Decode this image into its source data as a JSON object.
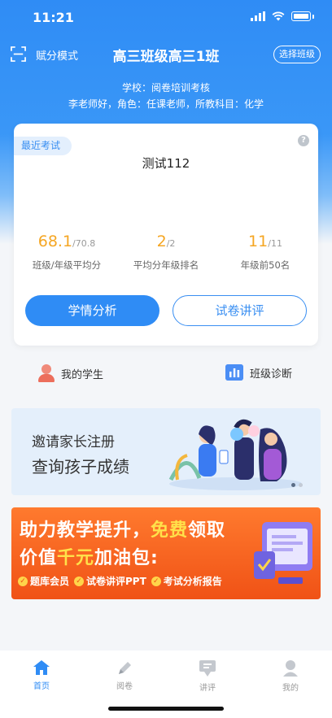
{
  "status_bar": {
    "time": "11:21"
  },
  "topnav": {
    "mode_label": "赋分模式",
    "class_title": "高三班级高三1班",
    "select_class": "选择班级"
  },
  "info": {
    "school": "学校：阅卷培训考核",
    "teacher": "李老师好，角色：任课老师，所教科目：化学"
  },
  "exam_card": {
    "tag": "最近考试",
    "help": "?",
    "exam_name": "测试112",
    "stats": [
      {
        "value": "68.1",
        "total": "/70.8",
        "label": "班级/年级平均分"
      },
      {
        "value": "2",
        "total": "/2",
        "label": "平均分年级排名"
      },
      {
        "value": "11",
        "total": "/11",
        "label": "年级前50名"
      }
    ],
    "btn_analysis": "学情分析",
    "btn_lecture": "试卷讲评"
  },
  "quick_links": {
    "my_students": "我的学生",
    "class_diagnosis": "班级诊断"
  },
  "invite_banner": {
    "line1": "邀请家长注册",
    "line2": "查询孩子成绩"
  },
  "promo_banner": {
    "line1_a": "助力教学提升，",
    "line1_hl": "免费",
    "line1_b": "领取",
    "line2_a": "价值",
    "line2_hl": "千元",
    "line2_b": "加油包:",
    "badges": [
      "题库会员",
      "试卷讲评PPT",
      "考试分析报告"
    ]
  },
  "tabbar": {
    "tabs": [
      {
        "label": "首页",
        "icon": "home-icon"
      },
      {
        "label": "阅卷",
        "icon": "pencil-icon"
      },
      {
        "label": "讲评",
        "icon": "lecture-icon"
      },
      {
        "label": "我的",
        "icon": "profile-icon"
      }
    ]
  },
  "colors": {
    "primary": "#2f8cf5",
    "accent": "#f5a623",
    "promo": "#f05216"
  }
}
